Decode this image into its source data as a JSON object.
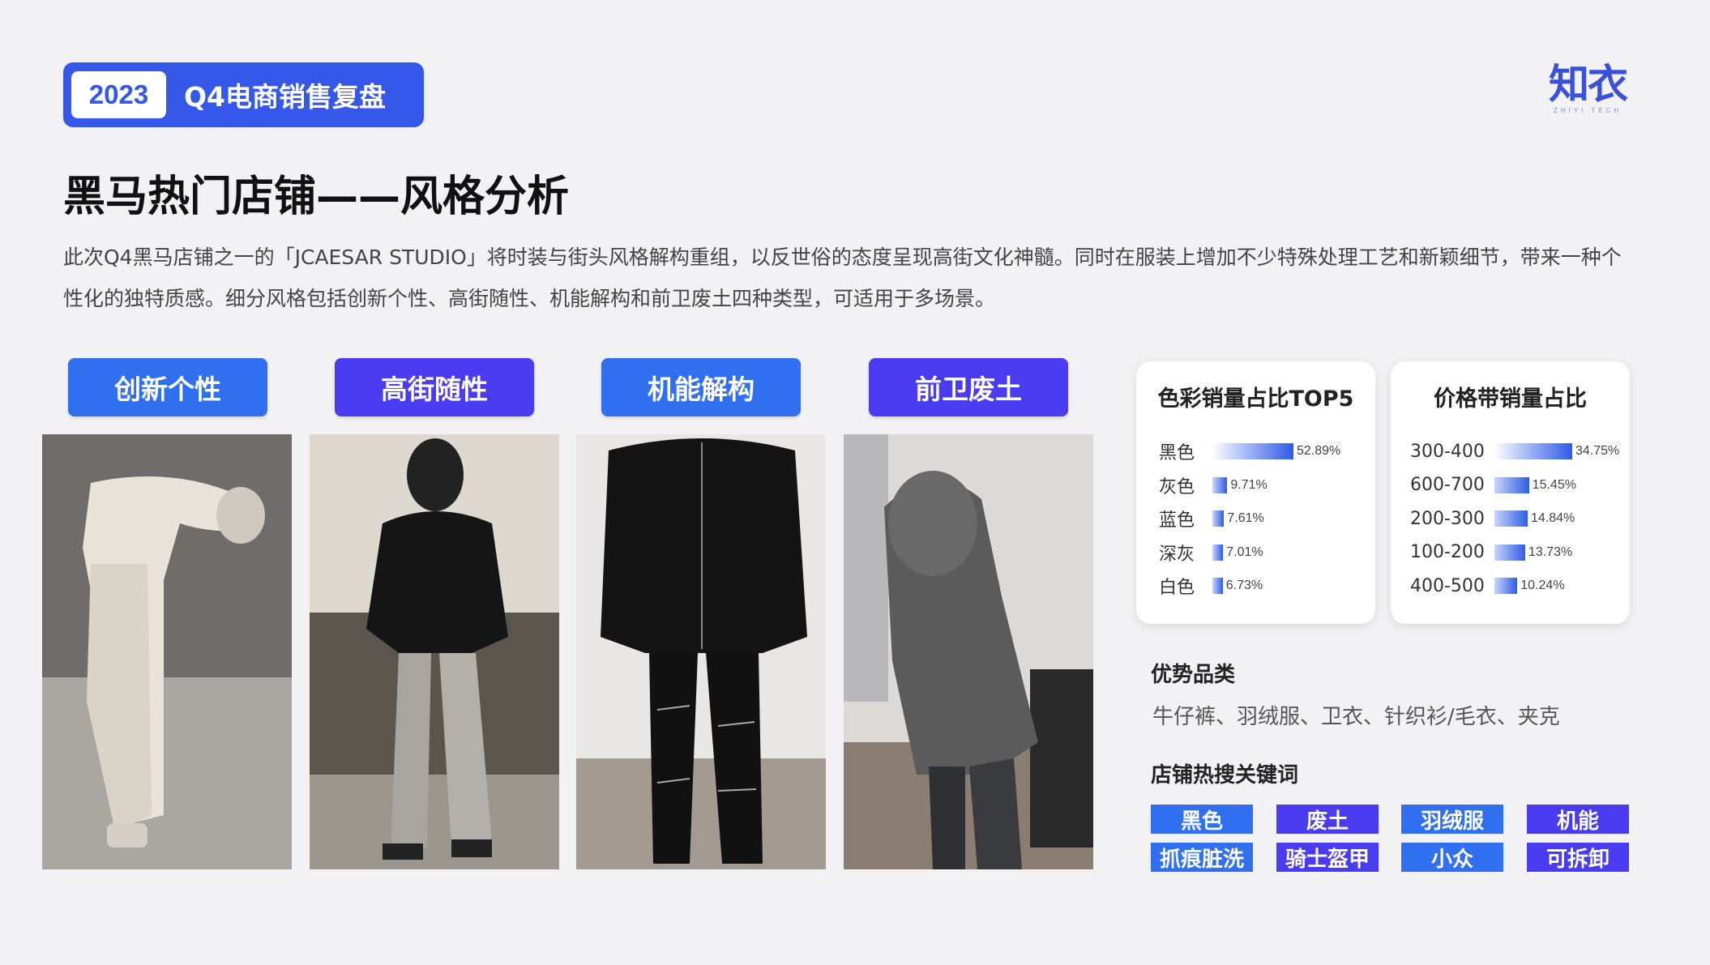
{
  "header": {
    "year": "2023",
    "title": "Q4电商销售复盘",
    "logo_text": "知衣",
    "logo_sub": "ZHIYI TECH"
  },
  "page_title": "黑马热门店铺——风格分析",
  "description": "此次Q4黑马店铺之一的「JCAESAR STUDIO」将时装与街头风格解构重组，以反世俗的态度呈现高街文化神髓。同时在服装上增加不少特殊处理工艺和新颖细节，带来一种个性化的独特质感。细分风格包括创新个性、高街随性、机能解构和前卫废土四种类型，可适用于多场景。",
  "styles": [
    {
      "label": "创新个性",
      "color": "#2f6ff0"
    },
    {
      "label": "高街随性",
      "color": "#4a3bf0"
    },
    {
      "label": "机能解构",
      "color": "#2f6ff0"
    },
    {
      "label": "前卫废土",
      "color": "#4a3bf0"
    }
  ],
  "color_card": {
    "title": "色彩销量占比TOP5",
    "rows": [
      {
        "label": "黑色",
        "value": 52.89,
        "text": "52.89%"
      },
      {
        "label": "灰色",
        "value": 9.71,
        "text": "9.71%"
      },
      {
        "label": "蓝色",
        "value": 7.61,
        "text": "7.61%"
      },
      {
        "label": "深灰",
        "value": 7.01,
        "text": "7.01%"
      },
      {
        "label": "白色",
        "value": 6.73,
        "text": "6.73%"
      }
    ]
  },
  "price_card": {
    "title": "价格带销量占比",
    "rows": [
      {
        "label": "300-400",
        "value": 34.75,
        "text": "34.75%"
      },
      {
        "label": "600-700",
        "value": 15.45,
        "text": "15.45%"
      },
      {
        "label": "200-300",
        "value": 14.84,
        "text": "14.84%"
      },
      {
        "label": "100-200",
        "value": 13.73,
        "text": "13.73%"
      },
      {
        "label": "400-500",
        "value": 10.24,
        "text": "10.24%"
      }
    ]
  },
  "advantage": {
    "title": "优势品类",
    "text": "牛仔裤、羽绒服、卫衣、针织衫/毛衣、夹克"
  },
  "keywords": {
    "title": "店铺热搜关键词",
    "items": [
      {
        "label": "黑色",
        "color": "#2f6ff0"
      },
      {
        "label": "废土",
        "color": "#4a3bf0"
      },
      {
        "label": "羽绒服",
        "color": "#2f6ff0"
      },
      {
        "label": "机能",
        "color": "#4a3bf0"
      },
      {
        "label": "抓痕脏洗",
        "color": "#2f6ff0"
      },
      {
        "label": "骑士盔甲",
        "color": "#4a3bf0"
      },
      {
        "label": "小众",
        "color": "#2f6ff0"
      },
      {
        "label": "可拆卸",
        "color": "#4a3bf0"
      }
    ]
  }
}
